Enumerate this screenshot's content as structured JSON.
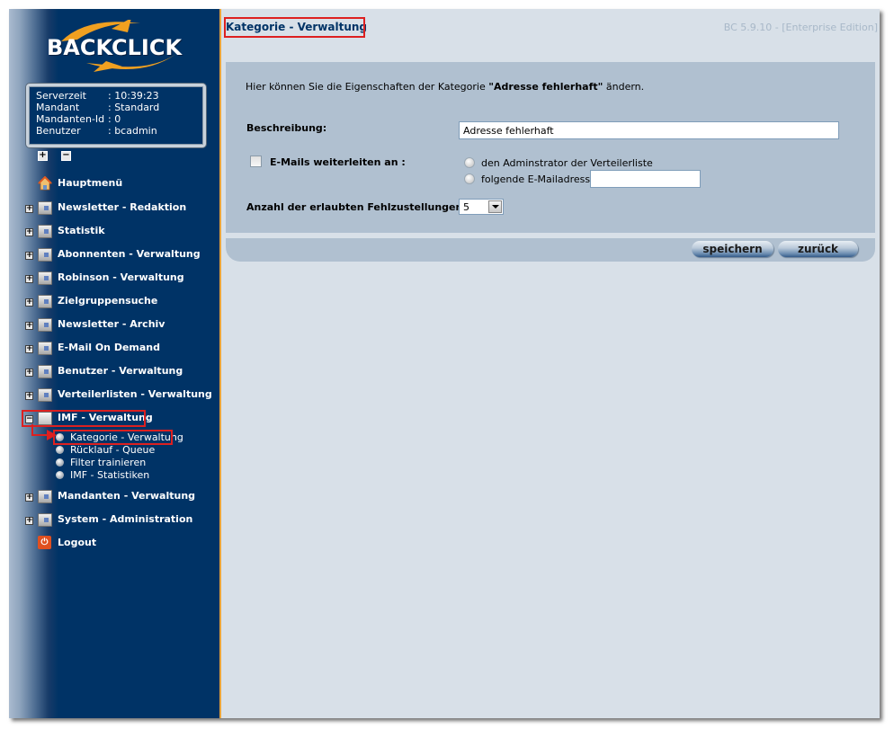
{
  "app": {
    "logo_text": "BACKCLICK",
    "version": "BC 5.9.10 - [Enterprise Edition]",
    "colors": {
      "sidebar": "#003366",
      "accent": "#e8a33a",
      "highlight": "#dd2020",
      "panel": "#b0c0d0"
    }
  },
  "info": [
    {
      "key": "Serverzeit",
      "value": ": 10:39:23"
    },
    {
      "key": "Mandant",
      "value": ": Standard"
    },
    {
      "key": "Mandanten-Id",
      "value": ": 0"
    },
    {
      "key": "Benutzer",
      "value": ": bcadmin"
    }
  ],
  "tree_controls": {
    "expand_all": "+",
    "collapse_all": "−"
  },
  "nav": {
    "home": {
      "label": "Hauptmenü",
      "icon": "home-icon"
    },
    "items": [
      {
        "label": "Newsletter - Redaktion",
        "toggle": "+",
        "icon": "folder-icon"
      },
      {
        "label": "Statistik",
        "toggle": "+",
        "icon": "folder-icon"
      },
      {
        "label": "Abonnenten - Verwaltung",
        "toggle": "+",
        "icon": "folder-icon"
      },
      {
        "label": "Robinson - Verwaltung",
        "toggle": "+",
        "icon": "folder-icon"
      },
      {
        "label": "Zielgruppensuche",
        "toggle": "+",
        "icon": "folder-icon"
      },
      {
        "label": "Newsletter - Archiv",
        "toggle": "+",
        "icon": "folder-icon"
      },
      {
        "label": "E-Mail On Demand",
        "toggle": "+",
        "icon": "folder-icon"
      },
      {
        "label": "Benutzer - Verwaltung",
        "toggle": "+",
        "icon": "folder-icon"
      },
      {
        "label": "Verteilerlisten - Verwaltung",
        "toggle": "+",
        "icon": "folder-icon"
      },
      {
        "label": "IMF - Verwaltung",
        "toggle": "−",
        "icon": "folder-open-icon",
        "expanded": true
      },
      {
        "label": "Mandanten - Verwaltung",
        "toggle": "+",
        "icon": "folder-icon"
      },
      {
        "label": "System - Administration",
        "toggle": "+",
        "icon": "folder-icon"
      }
    ],
    "sub_items": [
      {
        "label": "Kategorie - Verwaltung",
        "active": true
      },
      {
        "label": "Rücklauf - Queue"
      },
      {
        "label": "Filter trainieren"
      },
      {
        "label": "IMF - Statistiken"
      }
    ],
    "logout": {
      "label": "Logout",
      "icon": "power-icon"
    }
  },
  "page": {
    "title": "Kategorie - Verwaltung",
    "intro_prefix": "Hier können Sie die Eigenschaften der Kategorie ",
    "intro_category": "\"Adresse fehlerhaft\"",
    "intro_suffix": " ändern."
  },
  "form": {
    "description_label": "Beschreibung:",
    "description_value": "Adresse fehlerhaft",
    "forward_label": "E-Mails weiterleiten an :",
    "forward_checked": false,
    "radio_admin_label": "den Adminstrator der Verteilerliste",
    "radio_email_label": "folgende E-Mailadresse :",
    "email_value": "",
    "bounce_label": "Anzahl der erlaubten Fehlzustellungen:",
    "bounce_value": "5"
  },
  "buttons": {
    "save": "speichern",
    "back": "zurück"
  }
}
